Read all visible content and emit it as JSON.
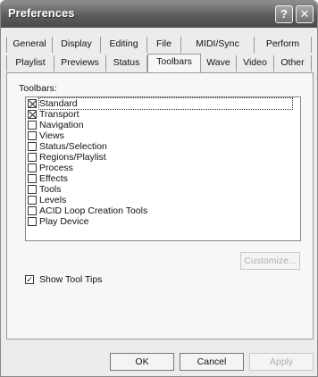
{
  "window": {
    "title": "Preferences",
    "help_glyph": "?",
    "close_glyph": "✕"
  },
  "tabs": {
    "row1": [
      "General",
      "Display",
      "Editing",
      "File",
      "MIDI/Sync",
      "Perform"
    ],
    "row2": [
      "Playlist",
      "Previews",
      "Status",
      "Toolbars",
      "Wave",
      "Video",
      "Other"
    ],
    "active": "Toolbars"
  },
  "toolbars": {
    "label": "Toolbars:",
    "items": [
      {
        "label": "Standard",
        "checked": true
      },
      {
        "label": "Transport",
        "checked": true
      },
      {
        "label": "Navigation",
        "checked": false
      },
      {
        "label": "Views",
        "checked": false
      },
      {
        "label": "Status/Selection",
        "checked": false
      },
      {
        "label": "Regions/Playlist",
        "checked": false
      },
      {
        "label": "Process",
        "checked": false
      },
      {
        "label": "Effects",
        "checked": false
      },
      {
        "label": "Tools",
        "checked": false
      },
      {
        "label": "Levels",
        "checked": false
      },
      {
        "label": "ACID Loop Creation Tools",
        "checked": false
      },
      {
        "label": "Play Device",
        "checked": false
      }
    ],
    "customize_label": "Customize..."
  },
  "show_tool_tips": {
    "label": "Show Tool Tips",
    "checked": true,
    "check_glyph": "✓"
  },
  "buttons": {
    "ok": "OK",
    "cancel": "Cancel",
    "apply": "Apply"
  }
}
